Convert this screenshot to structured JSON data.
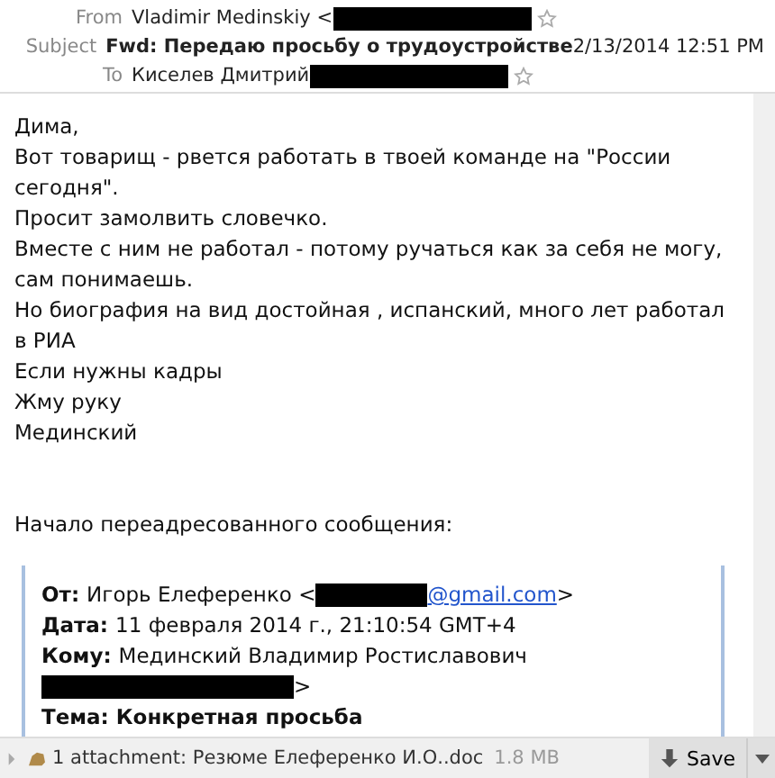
{
  "header": {
    "from": {
      "label": "From",
      "name": "Vladimir Medinskiy <"
    },
    "subject": {
      "label": "Subject",
      "text": "Fwd: Передаю просьбу о трудоустройстве",
      "date": "2/13/2014 12:51 PM"
    },
    "to": {
      "label": "To",
      "name": "Киселев Дмитрий"
    }
  },
  "body": [
    "Дима,",
    "Вот товарищ - рвется работать в твоей команде на \"России сегодня\".",
    "Просит замолвить словечко.",
    "Вместе с ним не работал - потому ручаться как за себя не могу, сам понимаешь.",
    "Но биография на вид достойная , испанский, много лет работал в РИА",
    "Если нужны кадры",
    "Жму руку",
    "Мединский"
  ],
  "forward_heading": "Начало переадресованного сообщения:",
  "quote": {
    "from": {
      "label": "От:",
      "text": "Игорь Елеференко <",
      "link": "@gmail.com",
      "tail": ">"
    },
    "date": {
      "label": "Дата:",
      "text": "11 февраля 2014 г., 21:10:54 GMT+4"
    },
    "to": {
      "label": "Кому:",
      "text": "Мединский Владимир Ростиславович",
      "tail": ">"
    },
    "subject": "Тема: Конкретная просьба"
  },
  "attachment": {
    "text": "1 attachment: Резюме Елеференко И.О..doc",
    "size": "1.8 MB",
    "save": "Save"
  }
}
